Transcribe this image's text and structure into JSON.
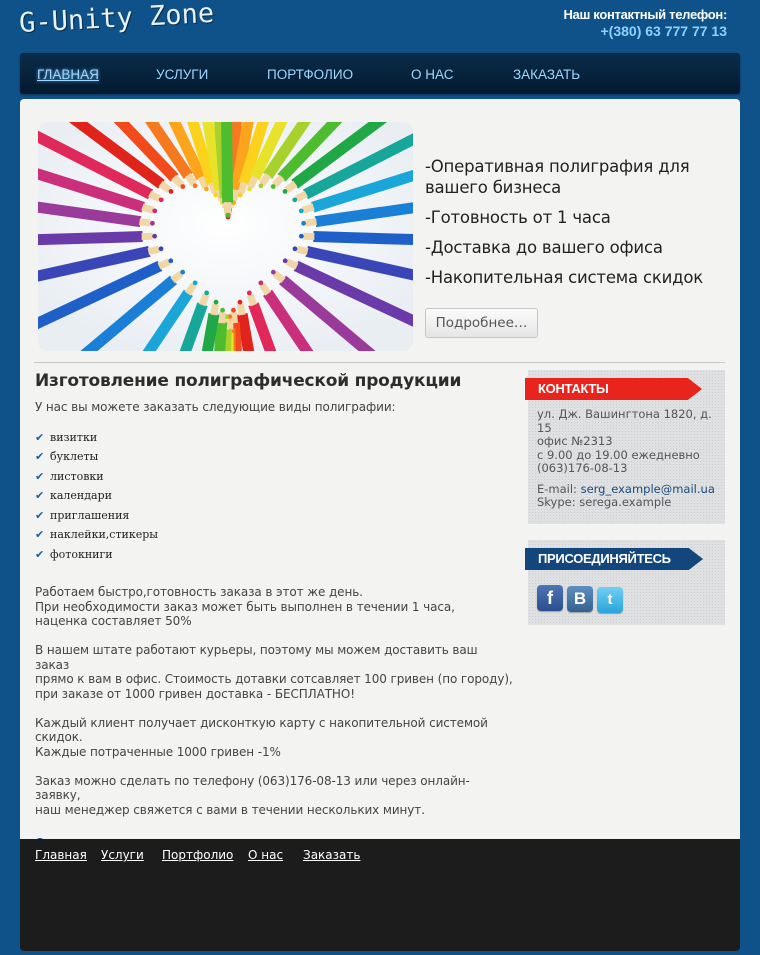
{
  "header": {
    "logo": "G-Unity Zone",
    "phone_title": "Наш контактный телефон:",
    "phone_number": "+(380) 63 777 77 13"
  },
  "nav": [
    "ГЛАВНАЯ",
    "УСЛУГИ",
    "ПОРТФОЛИО",
    "О НАС",
    "ЗАКАЗАТЬ"
  ],
  "hero": {
    "lines": [
      "-Оперативная полиграфия для вашего бизнеса",
      "-Готовность от 1 часа",
      "-Доставка до вашего офиса",
      "-Накопительная система скидок"
    ],
    "button": "Подробнее…"
  },
  "content": {
    "title": "Изготовление полиграфической продукции",
    "intro": "У нас вы можете заказать следующие виды полиграфии:",
    "items": [
      "визитки",
      "буклеты",
      "листовки",
      "календари",
      "приглашения",
      "наклейки,стикеры",
      "фотокниги"
    ],
    "paragraphs": [
      [
        "Работаем быстро,готовность заказа в этот же день.",
        "При необходимости заказ может быть выполнен в течении 1 часа,",
        "наценка составляет 50%"
      ],
      [
        "В нашем штате работают курьеры, поэтому мы можем доставить ваш заказ",
        "прямо к вам в офис. Стоимость дотавки сотсавляет 100 гривен (по городу),",
        "при заказе от 1000 гривен доставка - БЕСПЛАТНО!"
      ],
      [
        "Каждый клиент получает дисконткую карту с накопительной системой скидок.",
        "Каждые потраченные 1000 гривен -1%"
      ],
      [
        "Заказ можно сделать по телефону (063)176-08-13 или через онлайн-заявку,",
        "наш менеджер свяжется с вами в течении нескольких минут."
      ]
    ],
    "order_link": "Сделать заказ"
  },
  "sidebar": {
    "contacts_title": "КОНТАКТЫ",
    "address_lines": [
      "ул. Дж. Вашингтона 1820, д.",
      "15",
      "офис №2313",
      "с 9.00 до 19.00 ежедневно",
      "(063)176-08-13"
    ],
    "email_label": "E-mail:",
    "email": "serg_example@mail.ua",
    "skype_label": "Skype:",
    "skype": "serega.example",
    "social_title": "ПРИСОЕДИНЯЙТЕСЬ",
    "social_icons": [
      {
        "name": "facebook-icon",
        "glyph": "f"
      },
      {
        "name": "vkontakte-icon",
        "glyph": "B"
      },
      {
        "name": "twitter-icon",
        "glyph": "t"
      }
    ]
  },
  "footer": [
    "Главная",
    "Услуги",
    "Портфолио",
    "О нас",
    "Заказать"
  ],
  "colors": {
    "page_bg": "#0e5289",
    "nav_bg": "#041a2f",
    "nav_link": "#9ed6ff",
    "contacts_accent": "#e8241c",
    "social_accent": "#12467d",
    "footer_bg": "#1c1c1c"
  }
}
